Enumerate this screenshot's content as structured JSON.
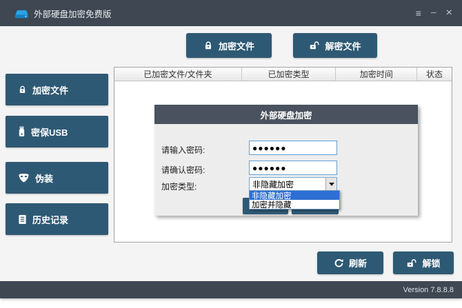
{
  "window": {
    "title": "外部硬盘加密免费版",
    "controls": {
      "menu": "≡",
      "minimize": "─",
      "close": "×"
    }
  },
  "toolbar": {
    "encrypt_button": "加密文件",
    "decrypt_button": "解密文件"
  },
  "sidebar": {
    "items": [
      {
        "label": "加密文件",
        "icon": "lock-icon"
      },
      {
        "label": "密保USB",
        "icon": "usb-icon"
      },
      {
        "label": "伪装",
        "icon": "mask-icon"
      },
      {
        "label": "历史记录",
        "icon": "history-icon"
      }
    ]
  },
  "table": {
    "headers": [
      "已加密文件/文件夹",
      "已加密类型",
      "加密时间",
      "状态"
    ],
    "rows": []
  },
  "dialog": {
    "title": "外部硬盘加密",
    "password_label": "请输入密码:",
    "password_value": "●●●●●●",
    "confirm_label": "请确认密码:",
    "confirm_value": "●●●●●●",
    "type_label": "加密类型:",
    "type_value": "非隐藏加密",
    "dropdown_options": [
      "非隐藏加密",
      "加密并隐藏"
    ],
    "dropdown_selected": "非隐藏加密"
  },
  "actions": {
    "refresh_button": "刷新",
    "unlock_button": "解锁"
  },
  "statusbar": {
    "version": "Version 7.8.8.8"
  },
  "colors": {
    "titlebar": "#3e4752",
    "steel_button": "#2e5974",
    "dialog_header": "#49525e",
    "dropdown_highlight": "#2d6fd4",
    "input_border": "#5e9fd4",
    "app_icon_blue": "#29a3e3"
  }
}
